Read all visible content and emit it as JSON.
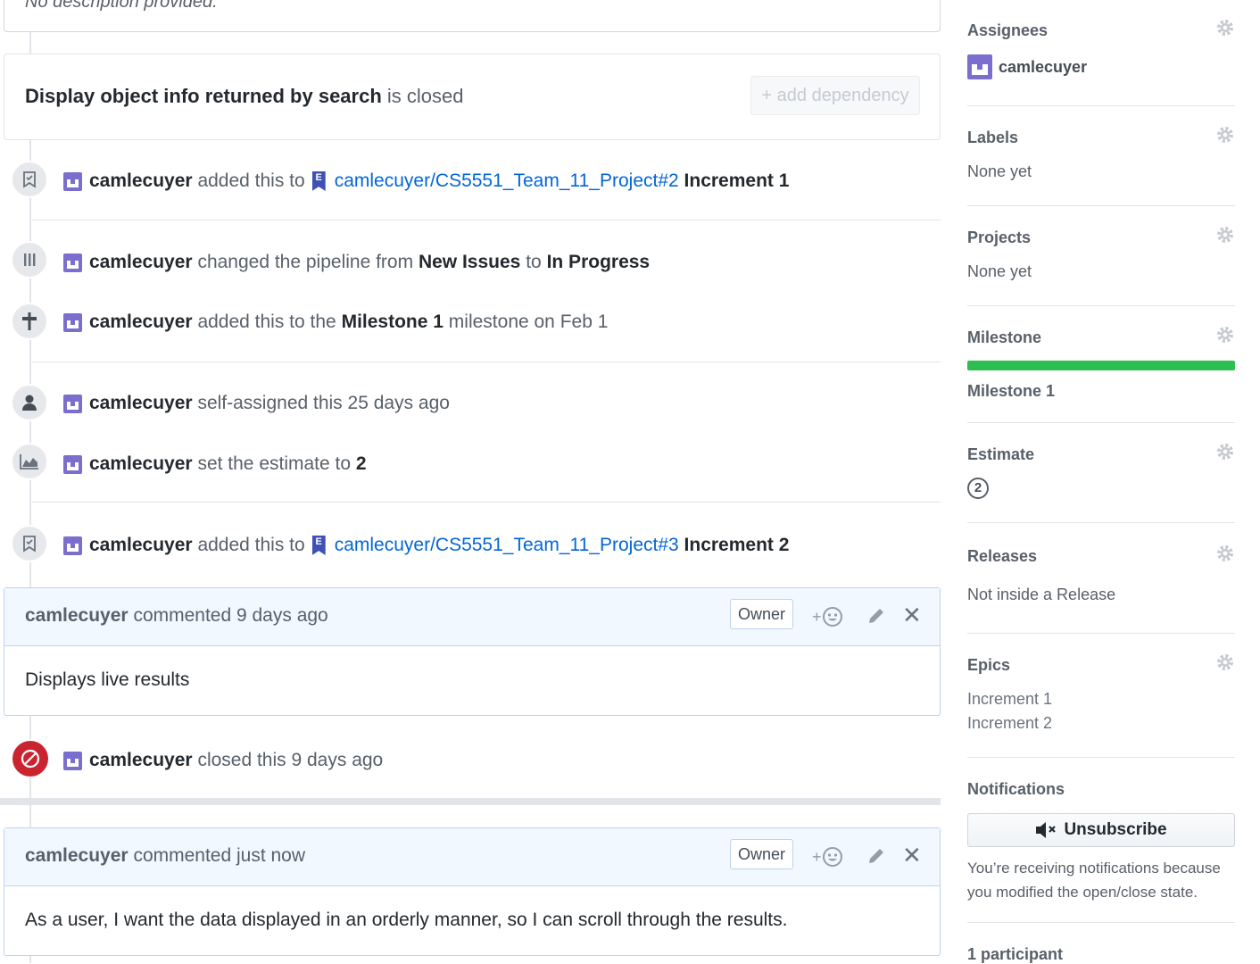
{
  "top_box": {
    "description": "No description provided."
  },
  "dependency": {
    "title": "Display object info returned by search",
    "status_prefix": "is",
    "status": "closed",
    "add_button": "+ add dependency"
  },
  "events": [
    {
      "user": "camlecuyer",
      "text": "added this to",
      "link": "camlecuyer/CS5551_Team_11_Project#2",
      "epic_letter": "E",
      "target": "Increment 1"
    },
    {
      "user": "camlecuyer",
      "text1": "changed the pipeline from",
      "from": "New Issues",
      "text2": "to",
      "to": "In Progress"
    },
    {
      "user": "camlecuyer",
      "text1": "added this to the",
      "milestone": "Milestone 1",
      "text2": "milestone on Feb 1"
    },
    {
      "user": "camlecuyer",
      "text": "self-assigned this 25 days ago"
    },
    {
      "user": "camlecuyer",
      "text": "set the estimate to",
      "value": "2"
    },
    {
      "user": "camlecuyer",
      "text": "added this to",
      "link": "camlecuyer/CS5551_Team_11_Project#3",
      "epic_letter": "E",
      "target": "Increment 2"
    },
    {
      "user": "camlecuyer",
      "text": "closed this 9 days ago"
    }
  ],
  "comments": [
    {
      "user": "camlecuyer",
      "meta": "commented 9 days ago",
      "role": "Owner",
      "react": "+",
      "body": "Displays live results"
    },
    {
      "user": "camlecuyer",
      "meta": "commented just now",
      "role": "Owner",
      "react": "+",
      "body": "As a user, I want the data displayed in an orderly manner, so I can scroll through the results."
    }
  ],
  "sidebar": {
    "assignees": {
      "title": "Assignees",
      "user": "camlecuyer"
    },
    "labels": {
      "title": "Labels",
      "value": "None yet"
    },
    "projects": {
      "title": "Projects",
      "value": "None yet"
    },
    "milestone": {
      "title": "Milestone",
      "name": "Milestone 1",
      "progress": 1.0,
      "color": "#2cbe4e"
    },
    "estimate": {
      "title": "Estimate",
      "value": "2"
    },
    "releases": {
      "title": "Releases",
      "value": "Not inside a Release"
    },
    "epics": {
      "title": "Epics",
      "items": [
        "Increment 1",
        "Increment 2"
      ]
    },
    "notifications": {
      "title": "Notifications",
      "button": "Unsubscribe",
      "line1": "You’re receiving notifications because",
      "line2": "you modified the open/close state."
    },
    "participants": {
      "title": "1 participant"
    }
  }
}
